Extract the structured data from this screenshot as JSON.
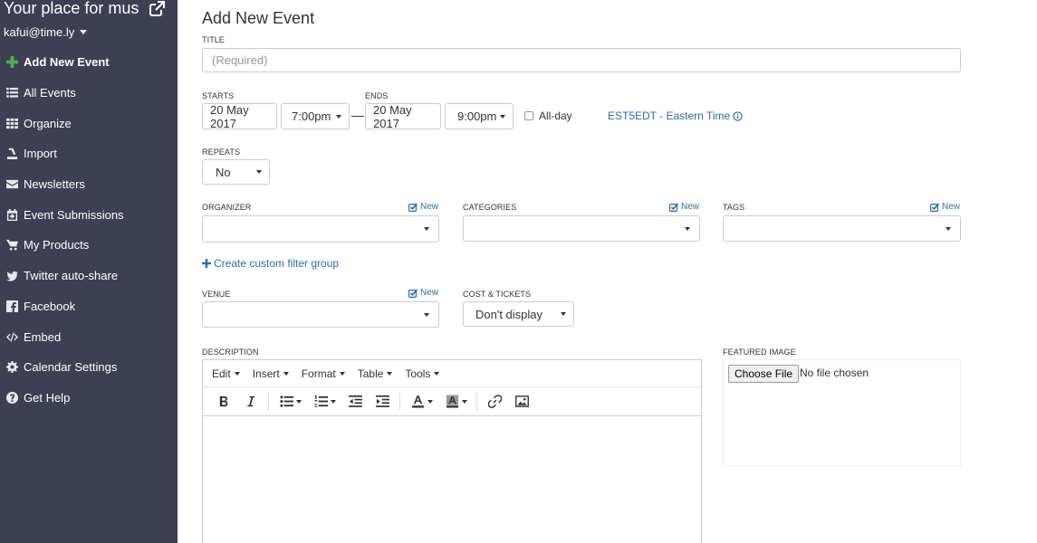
{
  "sidebar": {
    "site_title": "Your place for mus",
    "user_email": "kafui@time.ly",
    "items": [
      {
        "label": "Add New Event",
        "icon": "plus-icon"
      },
      {
        "label": "All Events",
        "icon": "list-icon"
      },
      {
        "label": "Organize",
        "icon": "grid-icon"
      },
      {
        "label": "Import",
        "icon": "import-icon"
      },
      {
        "label": "Newsletters",
        "icon": "envelope-icon"
      },
      {
        "label": "Event Submissions",
        "icon": "calendar-plus-icon"
      },
      {
        "label": "My Products",
        "icon": "cart-icon"
      },
      {
        "label": "Twitter auto-share",
        "icon": "twitter-icon"
      },
      {
        "label": "Facebook",
        "icon": "facebook-icon"
      },
      {
        "label": "Embed",
        "icon": "code-icon"
      },
      {
        "label": "Calendar Settings",
        "icon": "gear-icon"
      },
      {
        "label": "Get Help",
        "icon": "question-icon"
      }
    ]
  },
  "form": {
    "page_title": "Add New Event",
    "title_label": "TITLE",
    "title_placeholder": "(Required)",
    "starts_label": "STARTS",
    "start_date": "20 May 2017",
    "start_time": "7:00pm",
    "ends_label": "ENDS",
    "end_date": "20 May 2017",
    "end_time": "9:00pm",
    "dash": "—",
    "allday_label": "All-day",
    "timezone": "EST5EDT - Eastern Time",
    "repeats_label": "REPEATS",
    "repeats_value": "No",
    "organizer_label": "ORGANIZER",
    "categories_label": "CATEGORIES",
    "tags_label": "TAGS",
    "new_label": "New",
    "create_filter": "Create custom filter group",
    "venue_label": "VENUE",
    "cost_label": "COST & TICKETS",
    "cost_value": "Don't display",
    "description_label": "DESCRIPTION",
    "featured_label": "FEATURED IMAGE",
    "choose_file": "Choose File",
    "no_file": "No file chosen"
  },
  "editor": {
    "menus": [
      "Edit",
      "Insert",
      "Format",
      "Table",
      "Tools"
    ]
  },
  "colors": {
    "sidebar_bg": "#3d3f52",
    "link": "#2a6ea6",
    "active_icon": "#4caf50"
  }
}
